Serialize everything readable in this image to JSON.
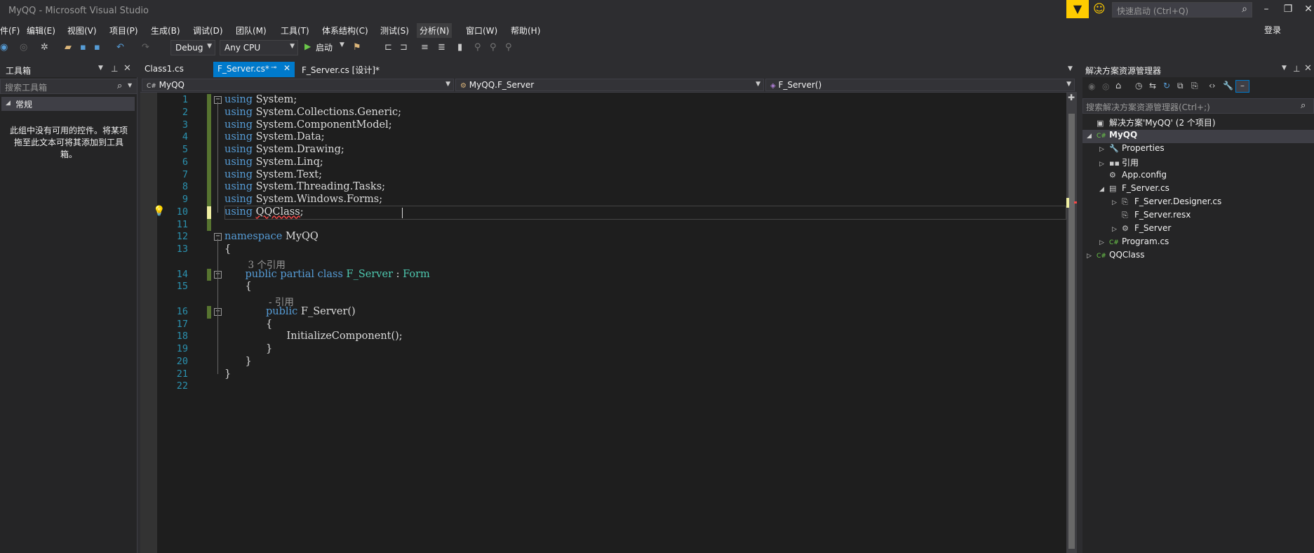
{
  "window": {
    "title": "MyQQ - Microsoft Visual Studio",
    "quick_launch_placeholder": "快速启动 (Ctrl+Q)",
    "login": "登录"
  },
  "menu": [
    "件(F)",
    "编辑(E)",
    "视图(V)",
    "项目(P)",
    "生成(B)",
    "调试(D)",
    "团队(M)",
    "工具(T)",
    "体系结构(C)",
    "测试(S)",
    "分析(N)",
    "窗口(W)",
    "帮助(H)"
  ],
  "toolbar": {
    "config": "Debug",
    "platform": "Any CPU",
    "start": "启动"
  },
  "toolbox": {
    "title": "工具箱",
    "search_placeholder": "搜索工具箱",
    "group": "常规",
    "empty_message": "此组中没有可用的控件。将某项拖至此文本可将其添加到工具箱。"
  },
  "tabs": [
    {
      "label": "Class1.cs",
      "active": false
    },
    {
      "label": "F_Server.cs*",
      "active": true
    },
    {
      "label": "F_Server.cs [设计]*",
      "active": false
    }
  ],
  "navbar": {
    "project": "MyQQ",
    "type": "MyQQ.F_Server",
    "member": "F_Server()"
  },
  "code": {
    "lines": [
      {
        "n": "1",
        "indent": 0,
        "parts": [
          {
            "t": "using",
            "c": "kw"
          },
          {
            "t": " System;"
          }
        ]
      },
      {
        "n": "2",
        "indent": 0,
        "parts": [
          {
            "t": "using",
            "c": "kw"
          },
          {
            "t": " System.Collections.Generic;"
          }
        ]
      },
      {
        "n": "3",
        "indent": 0,
        "parts": [
          {
            "t": "using",
            "c": "kw"
          },
          {
            "t": " System.ComponentModel;"
          }
        ]
      },
      {
        "n": "4",
        "indent": 0,
        "parts": [
          {
            "t": "using",
            "c": "kw"
          },
          {
            "t": " System.Data;"
          }
        ]
      },
      {
        "n": "5",
        "indent": 0,
        "parts": [
          {
            "t": "using",
            "c": "kw"
          },
          {
            "t": " System.Drawing;"
          }
        ]
      },
      {
        "n": "6",
        "indent": 0,
        "parts": [
          {
            "t": "using",
            "c": "kw"
          },
          {
            "t": " System.Linq;"
          }
        ]
      },
      {
        "n": "7",
        "indent": 0,
        "parts": [
          {
            "t": "using",
            "c": "kw"
          },
          {
            "t": " System.Text;"
          }
        ]
      },
      {
        "n": "8",
        "indent": 0,
        "parts": [
          {
            "t": "using",
            "c": "kw"
          },
          {
            "t": " System.Threading.Tasks;"
          }
        ]
      },
      {
        "n": "9",
        "indent": 0,
        "parts": [
          {
            "t": "using",
            "c": "kw"
          },
          {
            "t": " System.Windows.Forms;"
          }
        ]
      },
      {
        "n": "10",
        "indent": 0,
        "parts": [
          {
            "t": "using",
            "c": "kw"
          },
          {
            "t": " "
          },
          {
            "t": "QQClass",
            "c": "squig"
          },
          {
            "t": ";"
          }
        ]
      },
      {
        "n": "11",
        "indent": 0,
        "parts": []
      },
      {
        "n": "12",
        "indent": 0,
        "parts": [
          {
            "t": "namespace",
            "c": "kw"
          },
          {
            "t": " MyQQ"
          }
        ]
      },
      {
        "n": "13",
        "indent": 0,
        "parts": [
          {
            "t": "{"
          }
        ]
      },
      {
        "n": "",
        "indent": 1,
        "lens": "3 个引用"
      },
      {
        "n": "14",
        "indent": 1,
        "parts": [
          {
            "t": "public",
            "c": "kw"
          },
          {
            "t": " "
          },
          {
            "t": "partial",
            "c": "kw"
          },
          {
            "t": " "
          },
          {
            "t": "class",
            "c": "kw"
          },
          {
            "t": " "
          },
          {
            "t": "F_Server",
            "c": "ty"
          },
          {
            "t": " : "
          },
          {
            "t": "Form",
            "c": "ty"
          }
        ]
      },
      {
        "n": "15",
        "indent": 1,
        "parts": [
          {
            "t": "{"
          }
        ]
      },
      {
        "n": "",
        "indent": 2,
        "lens": "- 引用"
      },
      {
        "n": "16",
        "indent": 2,
        "parts": [
          {
            "t": "public",
            "c": "kw"
          },
          {
            "t": " F_Server()"
          }
        ]
      },
      {
        "n": "17",
        "indent": 2,
        "parts": [
          {
            "t": "{"
          }
        ]
      },
      {
        "n": "18",
        "indent": 3,
        "parts": [
          {
            "t": "InitializeComponent();"
          }
        ]
      },
      {
        "n": "19",
        "indent": 2,
        "parts": [
          {
            "t": "}"
          }
        ]
      },
      {
        "n": "20",
        "indent": 1,
        "parts": [
          {
            "t": "}"
          }
        ]
      },
      {
        "n": "21",
        "indent": 0,
        "parts": [
          {
            "t": "}"
          }
        ]
      },
      {
        "n": "22",
        "indent": 0,
        "parts": []
      }
    ]
  },
  "solution_explorer": {
    "title": "解决方案资源管理器",
    "search_placeholder": "搜索解决方案资源管理器(Ctrl+;)",
    "tree": [
      {
        "label": "解决方案'MyQQ' (2 个项目)",
        "level": 0,
        "arrow": "",
        "icon": "▣",
        "bold": false
      },
      {
        "label": "MyQQ",
        "level": 0,
        "arrow": "◢",
        "icon": "C#",
        "bold": true
      },
      {
        "label": "Properties",
        "level": 1,
        "arrow": "▷",
        "icon": "🔧",
        "bold": false
      },
      {
        "label": "引用",
        "level": 1,
        "arrow": "▷",
        "icon": "▪▪",
        "bold": false
      },
      {
        "label": "App.config",
        "level": 1,
        "arrow": "",
        "icon": "⚙",
        "bold": false
      },
      {
        "label": "F_Server.cs",
        "level": 1,
        "arrow": "◢",
        "icon": "▤",
        "bold": false
      },
      {
        "label": "F_Server.Designer.cs",
        "level": 2,
        "arrow": "▷",
        "icon": "⎘",
        "bold": false
      },
      {
        "label": "F_Server.resx",
        "level": 2,
        "arrow": "",
        "icon": "⎘",
        "bold": false
      },
      {
        "label": "F_Server",
        "level": 2,
        "arrow": "▷",
        "icon": "⚙",
        "bold": false
      },
      {
        "label": "Program.cs",
        "level": 1,
        "arrow": "▷",
        "icon": "C#",
        "bold": false
      },
      {
        "label": "QQClass",
        "level": 0,
        "arrow": "▷",
        "icon": "C#",
        "bold": false
      }
    ]
  }
}
